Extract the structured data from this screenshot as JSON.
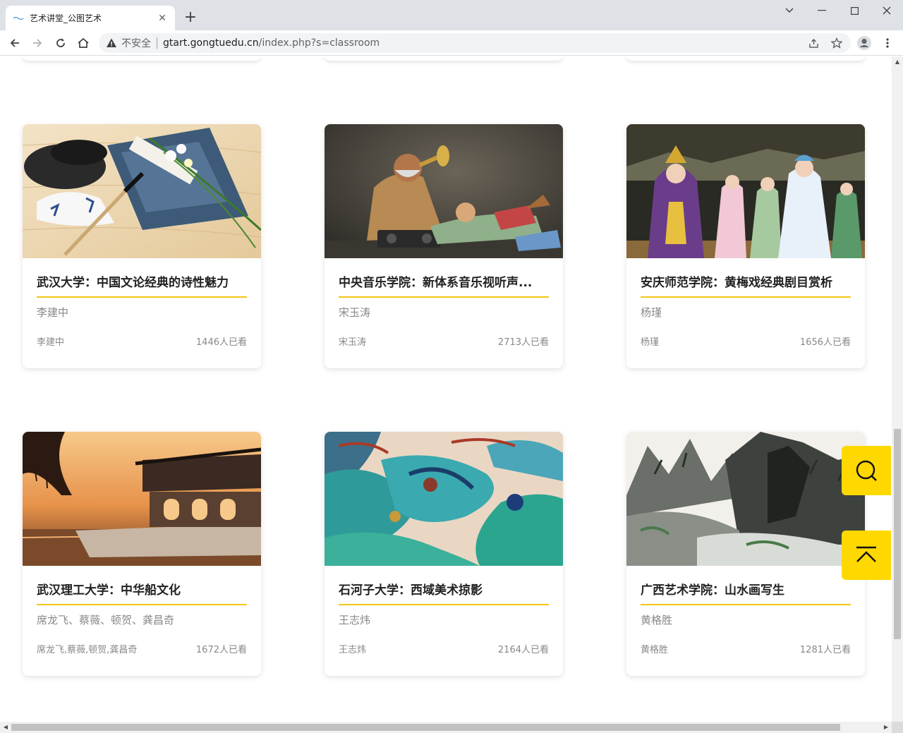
{
  "browser": {
    "tab_title": "艺术讲堂_公图艺术",
    "security_label": "不安全",
    "url_host": "gtart.gongtuedu.cn",
    "url_path": "/index.php?s=classroom"
  },
  "courses": [
    {
      "title": "武汉大学：中国文论经典的诗性魅力",
      "teacher": "李建中",
      "author": "李建中",
      "views": "1446人已看",
      "image": "ink-book-calligraphy"
    },
    {
      "title": "中央音乐学院：新体系音乐视听声...",
      "teacher": "宋玉涛",
      "author": "宋玉涛",
      "views": "2713人已看",
      "image": "clay-figure-trumpet"
    },
    {
      "title": "安庆师范学院：黄梅戏经典剧目赏析",
      "teacher": "杨瑾",
      "author": "杨瑾",
      "views": "1656人已看",
      "image": "huangmei-opera-stage"
    },
    {
      "title": "武汉理工大学：中华船文化",
      "teacher": "席龙飞、蔡薇、顿贺、龚昌奇",
      "author": "席龙飞,蔡薇,顿贺,龚昌奇",
      "views": "1672人已看",
      "image": "marble-boat-sunset"
    },
    {
      "title": "石河子大学：西域美术掠影",
      "teacher": "王志炜",
      "author": "王志炜",
      "views": "2164人已看",
      "image": "dunhuang-mural"
    },
    {
      "title": "广西艺术学院：山水画写生",
      "teacher": "黄格胜",
      "author": "黄格胜",
      "views": "1281人已看",
      "image": "landscape-ink-painting"
    }
  ],
  "floating": {
    "search_icon": "search-icon",
    "top_icon": "back-to-top-icon",
    "accent": "#ffd800"
  },
  "colors": {
    "title_underline": "#f5c518"
  }
}
